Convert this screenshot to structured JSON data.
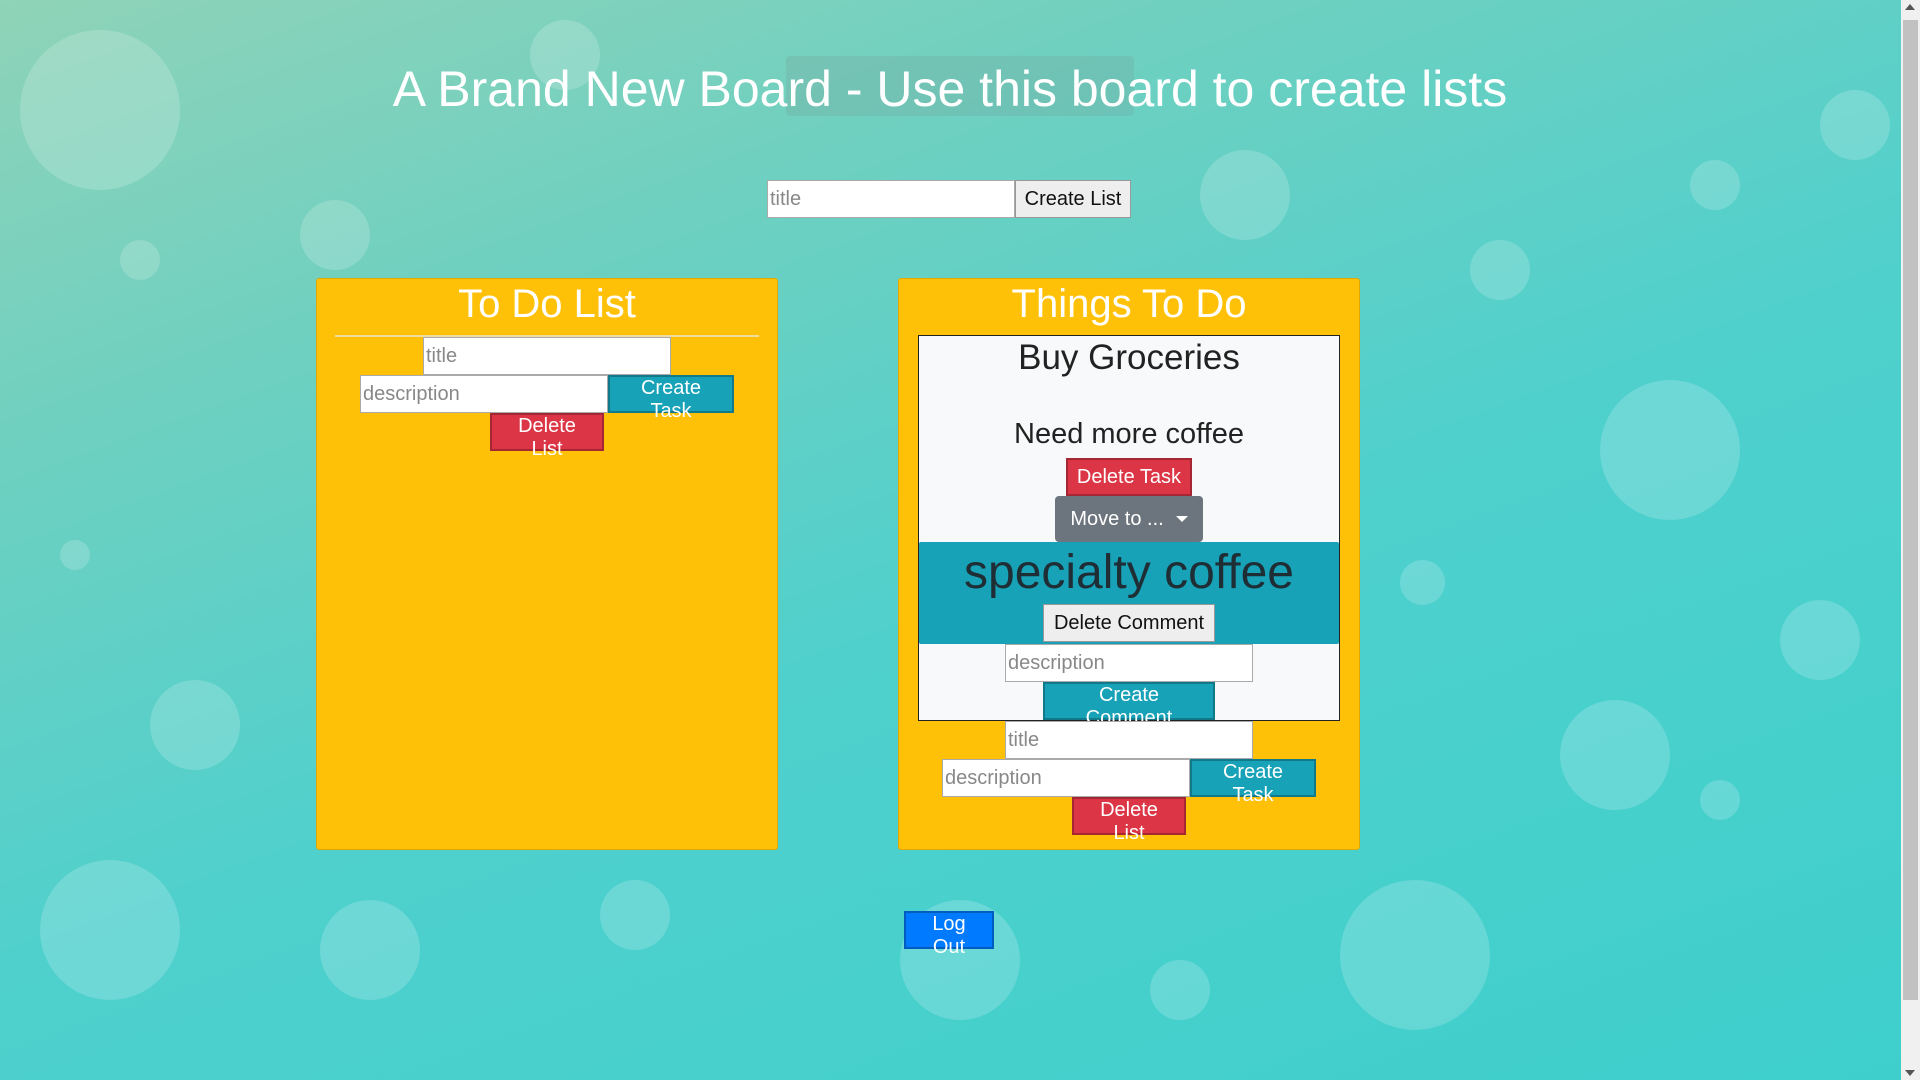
{
  "board": {
    "title": "A Brand New Board - Use this board to create lists"
  },
  "create_list": {
    "title_placeholder": "title",
    "button_label": "Create List"
  },
  "lists": [
    {
      "title": "To Do List",
      "task_title_placeholder": "title",
      "task_description_placeholder": "description",
      "create_task_label": "Create Task",
      "delete_list_label": "Delete List"
    },
    {
      "title": "Things To Do",
      "tasks": [
        {
          "title": "Buy Groceries",
          "description": "Need more coffee",
          "delete_task_label": "Delete Task",
          "move_to_label": "Move to ...",
          "comments": [
            {
              "text": "specialty coffee",
              "delete_label": "Delete Comment"
            }
          ],
          "comment_placeholder": "description",
          "create_comment_label": "Create Comment"
        }
      ],
      "task_title_placeholder": "title",
      "task_description_placeholder": "description",
      "create_task_label": "Create Task",
      "delete_list_label": "Delete List"
    }
  ],
  "logout_label": "Log Out",
  "colors": {
    "list_background": "#ffc107",
    "info": "#17a2b8",
    "danger": "#dc3545",
    "primary": "#007bff",
    "secondary": "#6c757d"
  }
}
